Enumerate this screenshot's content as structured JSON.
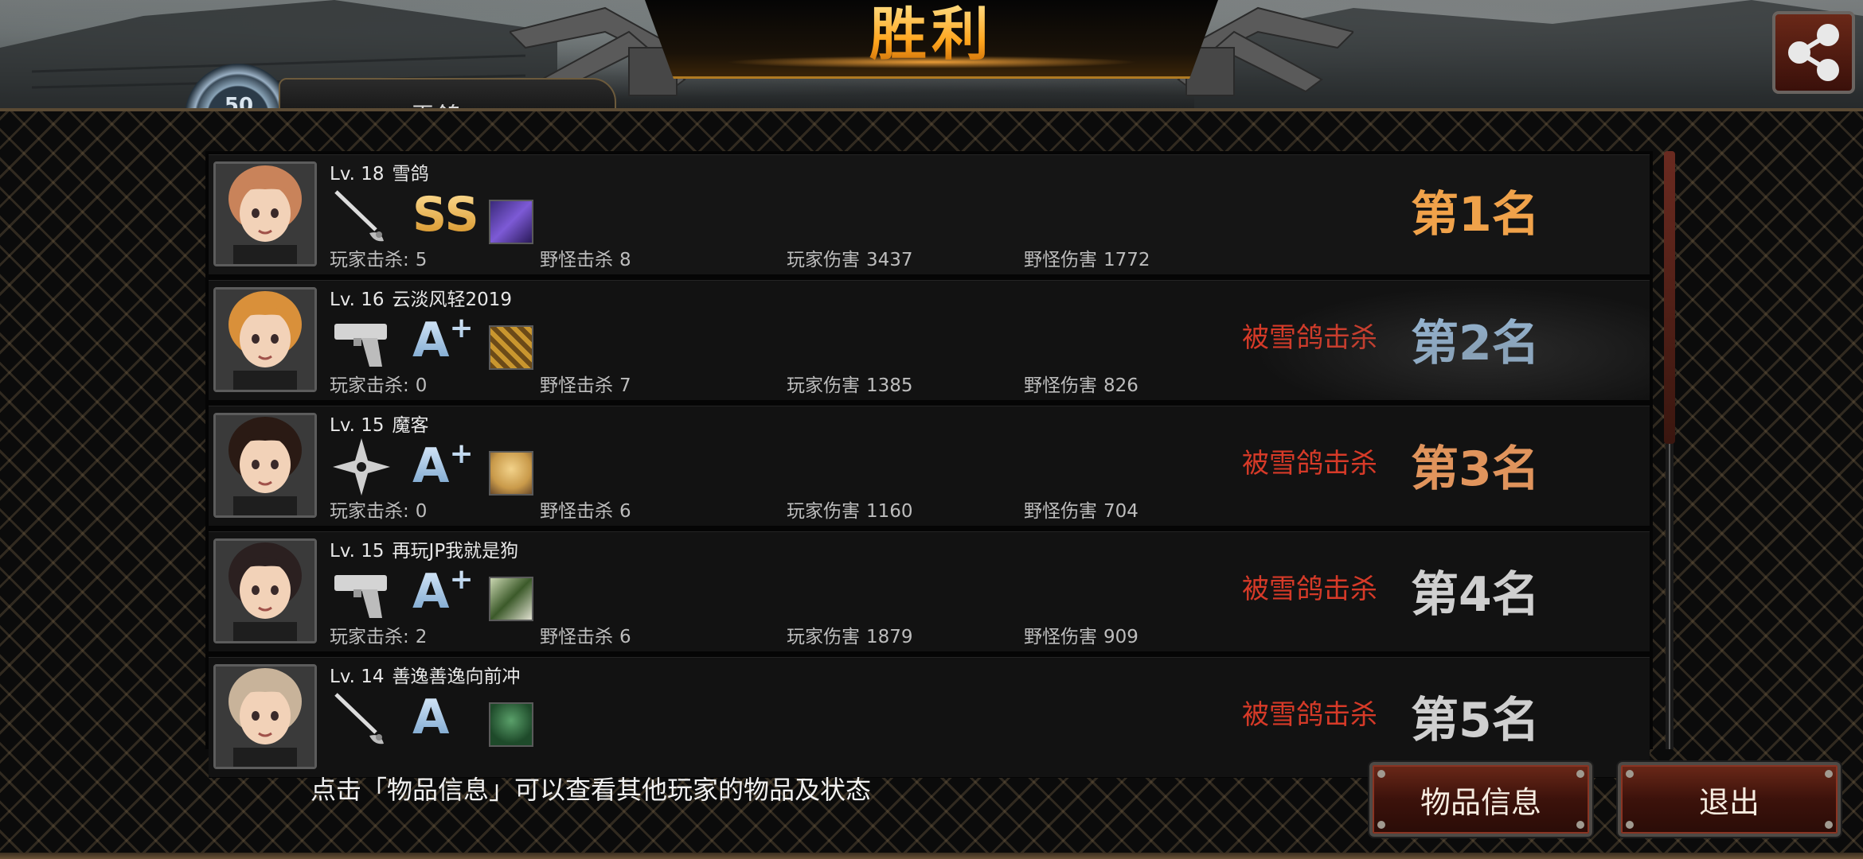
{
  "title": "胜利",
  "header_player": {
    "level_badge": "50",
    "name": "雪鸽"
  },
  "players": [
    {
      "level": "Lv. 18",
      "name": "雪鸽",
      "weapon_icon": "rapier-icon",
      "grade": "SS",
      "grade_plus": "",
      "item_icon": "purple-gear-item-icon",
      "stats": [
        {
          "label": "玩家击杀:",
          "value": "5"
        },
        {
          "label": "野怪击杀",
          "value": "8"
        },
        {
          "label": "玩家伤害",
          "value": "3437"
        },
        {
          "label": "野怪伤害",
          "value": "1772"
        }
      ],
      "killed_by": "",
      "rank": "第1名",
      "rank_color": "#f0a24a",
      "hair_color": "#c9835a"
    },
    {
      "level": "Lv. 16",
      "name": "云淡风轻2019",
      "weapon_icon": "pistol-icon",
      "grade": "A",
      "grade_plus": "+",
      "item_icon": "bullet-item-icon",
      "stats": [
        {
          "label": "玩家击杀:",
          "value": "0"
        },
        {
          "label": "野怪击杀",
          "value": "7"
        },
        {
          "label": "玩家伤害",
          "value": "1385"
        },
        {
          "label": "野怪伤害",
          "value": "826"
        }
      ],
      "killed_by": "被雪鸽击杀",
      "rank": "第2名",
      "rank_color": "#9fc3e4",
      "hair_color": "#d9903a"
    },
    {
      "level": "Lv. 15",
      "name": "魔客",
      "weapon_icon": "shuriken-icon",
      "grade": "A",
      "grade_plus": "+",
      "item_icon": "blonde-portrait-item-icon",
      "stats": [
        {
          "label": "玩家击杀:",
          "value": "0"
        },
        {
          "label": "野怪击杀",
          "value": "6"
        },
        {
          "label": "玩家伤害",
          "value": "1160"
        },
        {
          "label": "野怪伤害",
          "value": "704"
        }
      ],
      "killed_by": "被雪鸽击杀",
      "rank": "第3名",
      "rank_color": "#e0945c",
      "hair_color": "#2a1a14"
    },
    {
      "level": "Lv. 15",
      "name": "再玩JP我就是狗",
      "weapon_icon": "pistol-icon",
      "grade": "A",
      "grade_plus": "+",
      "item_icon": "green-portrait-item-icon",
      "stats": [
        {
          "label": "玩家击杀:",
          "value": "2"
        },
        {
          "label": "野怪击杀",
          "value": "6"
        },
        {
          "label": "玩家伤害",
          "value": "1879"
        },
        {
          "label": "野怪伤害",
          "value": "909"
        }
      ],
      "killed_by": "被雪鸽击杀",
      "rank": "第4名",
      "rank_color": "#cfcfcf",
      "hair_color": "#2b2020"
    },
    {
      "level": "Lv. 14",
      "name": "善逸善逸向前冲",
      "weapon_icon": "rapier-icon",
      "grade": "A",
      "grade_plus": "",
      "item_icon": "soldier-portrait-item-icon",
      "stats": [],
      "killed_by": "被雪鸽击杀",
      "rank": "第5名",
      "rank_color": "#cfcfcf",
      "hair_color": "#c8b39a"
    }
  ],
  "hint": "点击「物品信息」可以查看其他玩家的物品及状态",
  "buttons": {
    "item_info": "物品信息",
    "exit": "退出"
  },
  "share_icon": "share-icon"
}
